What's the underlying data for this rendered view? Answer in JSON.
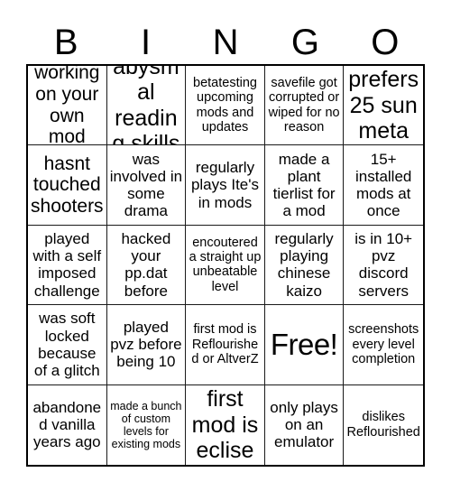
{
  "header": {
    "letters": [
      "B",
      "I",
      "N",
      "G",
      "O"
    ]
  },
  "grid": {
    "rows": 5,
    "columns": 5,
    "border_color": "#000000",
    "background_color": "#ffffff",
    "text_color": "#000000",
    "cells": [
      {
        "text": "working on your own mod",
        "size": "lg",
        "free": false
      },
      {
        "text": "abysmal reading skills",
        "size": "xl",
        "free": false
      },
      {
        "text": "betatesting upcoming mods and updates",
        "size": "sm",
        "free": false
      },
      {
        "text": "savefile got corrupted or wiped for no reason",
        "size": "sm",
        "free": false
      },
      {
        "text": "prefers 25 sun meta",
        "size": "xl",
        "free": false
      },
      {
        "text": "hasnt touched shooters",
        "size": "lg",
        "free": false
      },
      {
        "text": "was involved in some drama",
        "size": "md",
        "free": false
      },
      {
        "text": "regularly plays Ite's in mods",
        "size": "md",
        "free": false
      },
      {
        "text": "made a plant tierlist for a mod",
        "size": "md",
        "free": false
      },
      {
        "text": "15+ installed mods at once",
        "size": "md",
        "free": false
      },
      {
        "text": "played with a self imposed challenge",
        "size": "md",
        "free": false
      },
      {
        "text": "hacked your pp.dat before",
        "size": "md",
        "free": false
      },
      {
        "text": "encoutered a straight up unbeatable level",
        "size": "sm",
        "free": false
      },
      {
        "text": "regularly playing chinese kaizo",
        "size": "md",
        "free": false
      },
      {
        "text": "is in 10+ pvz discord servers",
        "size": "md",
        "free": false
      },
      {
        "text": "was soft locked because of a glitch",
        "size": "md",
        "free": false
      },
      {
        "text": "played pvz before being 10",
        "size": "md",
        "free": false
      },
      {
        "text": "first mod is Reflourished or AltverZ",
        "size": "sm",
        "free": false
      },
      {
        "text": "Free!",
        "size": "free",
        "free": true
      },
      {
        "text": "screenshots every level completion",
        "size": "sm",
        "free": false
      },
      {
        "text": "abandoned vanilla years ago",
        "size": "md",
        "free": false
      },
      {
        "text": "made a bunch of custom levels for existing mods",
        "size": "xs",
        "free": false
      },
      {
        "text": "first mod is eclise",
        "size": "xl",
        "free": false
      },
      {
        "text": "only plays on an emulator",
        "size": "md",
        "free": false
      },
      {
        "text": "dislikes Reflourished",
        "size": "sm",
        "free": false
      }
    ]
  }
}
